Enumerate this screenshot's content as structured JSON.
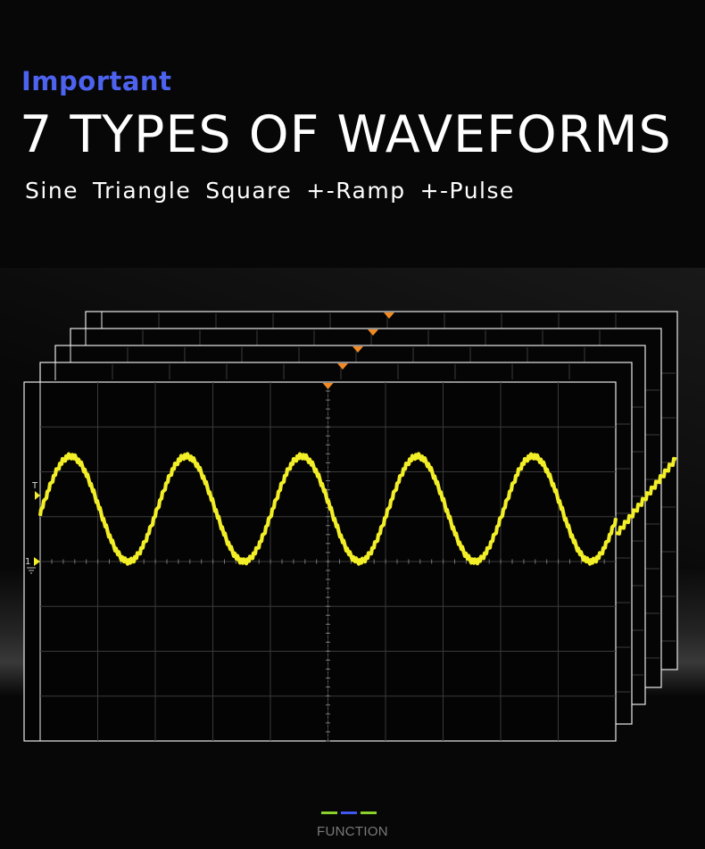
{
  "header": {
    "eyebrow": "Important",
    "title": "7 TYPES OF WAVEFORMS",
    "waveform_types": [
      "Sine",
      "Triangle",
      "Square",
      "+-Ramp",
      "+-Pulse"
    ]
  },
  "scope": {
    "trigger_label": "T",
    "channel_label": "1",
    "trace_color": "#f2ee27",
    "trigger_marker_color": "#f08a24",
    "frame_color": "#e9e9e9",
    "grid_color": "#3a3a3a"
  },
  "footer": {
    "indicator_colors": [
      "#8bd22b",
      "#3f58ee",
      "#8bd22b"
    ],
    "caption": "FUNCTION"
  },
  "colors": {
    "background": "#070707",
    "accent": "#4d63f0",
    "text": "#ffffff"
  }
}
